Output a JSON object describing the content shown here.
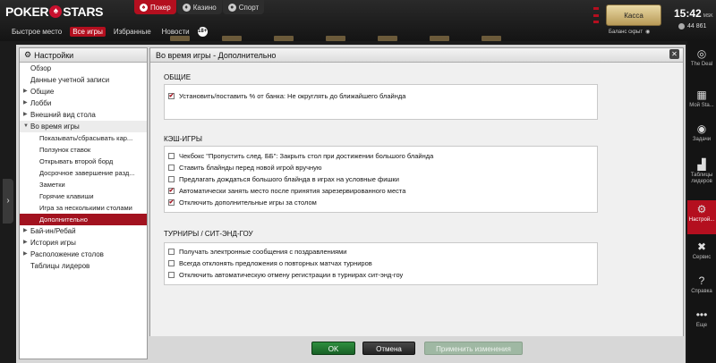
{
  "app": {
    "logo_left": "POKER",
    "logo_right": "STARS",
    "product_tabs": [
      "Покер",
      "Казино",
      "Спорт"
    ],
    "lobby_tabs": [
      "Быстрое место",
      "Все игры",
      "Избранные",
      "Новости"
    ],
    "age_badge": "18+",
    "cashier_label": "Касса",
    "balance_label": "Баланс скрыт",
    "time": "15:42",
    "timezone": "MSK",
    "players_online": "44 861"
  },
  "right_sidebar": [
    {
      "label": "The Deal",
      "icon": "deal-icon"
    },
    {
      "label": "Мой Sta...",
      "icon": "stats-icon"
    },
    {
      "label": "Задачи",
      "icon": "target-icon"
    },
    {
      "label": "Таблицы лидеров",
      "icon": "leaderboard-icon"
    },
    {
      "label": "Настрой...",
      "icon": "gear-icon"
    },
    {
      "label": "Сервис",
      "icon": "tools-icon"
    },
    {
      "label": "Справка",
      "icon": "help-icon"
    },
    {
      "label": "Еще",
      "icon": "more-icon"
    }
  ],
  "settings": {
    "title": "Настройки",
    "nav": [
      {
        "label": "Обзор",
        "level": 0,
        "arrow": ""
      },
      {
        "label": "Данные учетной записи",
        "level": 0,
        "arrow": ""
      },
      {
        "label": "Общие",
        "level": 0,
        "arrow": "▶"
      },
      {
        "label": "Лобби",
        "level": 0,
        "arrow": "▶"
      },
      {
        "label": "Внешний вид стола",
        "level": 0,
        "arrow": "▶"
      },
      {
        "label": "Во время игры",
        "level": 0,
        "arrow": "▼"
      },
      {
        "label": "Показывать/сбрасывать кар...",
        "level": 1,
        "arrow": ""
      },
      {
        "label": "Ползунок ставок",
        "level": 1,
        "arrow": ""
      },
      {
        "label": "Открывать второй борд",
        "level": 1,
        "arrow": ""
      },
      {
        "label": "Досрочное завершение разд...",
        "level": 1,
        "arrow": ""
      },
      {
        "label": "Заметки",
        "level": 1,
        "arrow": ""
      },
      {
        "label": "Горячие клавиши",
        "level": 1,
        "arrow": ""
      },
      {
        "label": "Игра за несколькими столами",
        "level": 1,
        "arrow": ""
      },
      {
        "label": "Дополнительно",
        "level": 1,
        "arrow": "",
        "selected": true
      },
      {
        "label": "Бай-ин/Ребай",
        "level": 0,
        "arrow": "▶"
      },
      {
        "label": "История игры",
        "level": 0,
        "arrow": "▶"
      },
      {
        "label": "Расположение столов",
        "level": 0,
        "arrow": "▶"
      },
      {
        "label": "Таблицы лидеров",
        "level": 0,
        "arrow": ""
      }
    ],
    "panel_title": "Во время игры - Дополнительно",
    "sections": {
      "general": {
        "title": "ОБЩИЕ",
        "options": [
          {
            "label": "Установить/поставить % от банка: Не округлять до ближайшего блайнда",
            "checked": true
          }
        ]
      },
      "cash": {
        "title": "КЭШ-ИГРЫ",
        "options": [
          {
            "label": "Чекбокс \"Пропустить след. ББ\": Закрыть стол при достижении большого блайнда",
            "checked": false
          },
          {
            "label": "Ставить блайнды перед новой игрой вручную",
            "checked": false
          },
          {
            "label": "Предлагать дождаться большого блайнда в играх на условные фишки",
            "checked": false
          },
          {
            "label": "Автоматически занять место после принятия зарезервированного места",
            "checked": true
          },
          {
            "label": "Отключить дополнительные игры за столом",
            "checked": true
          }
        ]
      },
      "tournaments": {
        "title": "ТУРНИРЫ / СИТ-ЭНД-ГОУ",
        "options": [
          {
            "label": "Получать электронные сообщения с поздравлениями",
            "checked": false
          },
          {
            "label": "Всегда отклонять предложения о повторных матчах турниров",
            "checked": false
          },
          {
            "label": "Отключить автоматическую отмену регистрации в турнирах сит-энд-гоу",
            "checked": false
          }
        ]
      }
    },
    "buttons": {
      "ok": "OK",
      "cancel": "Отмена",
      "apply": "Применить изменения"
    }
  }
}
